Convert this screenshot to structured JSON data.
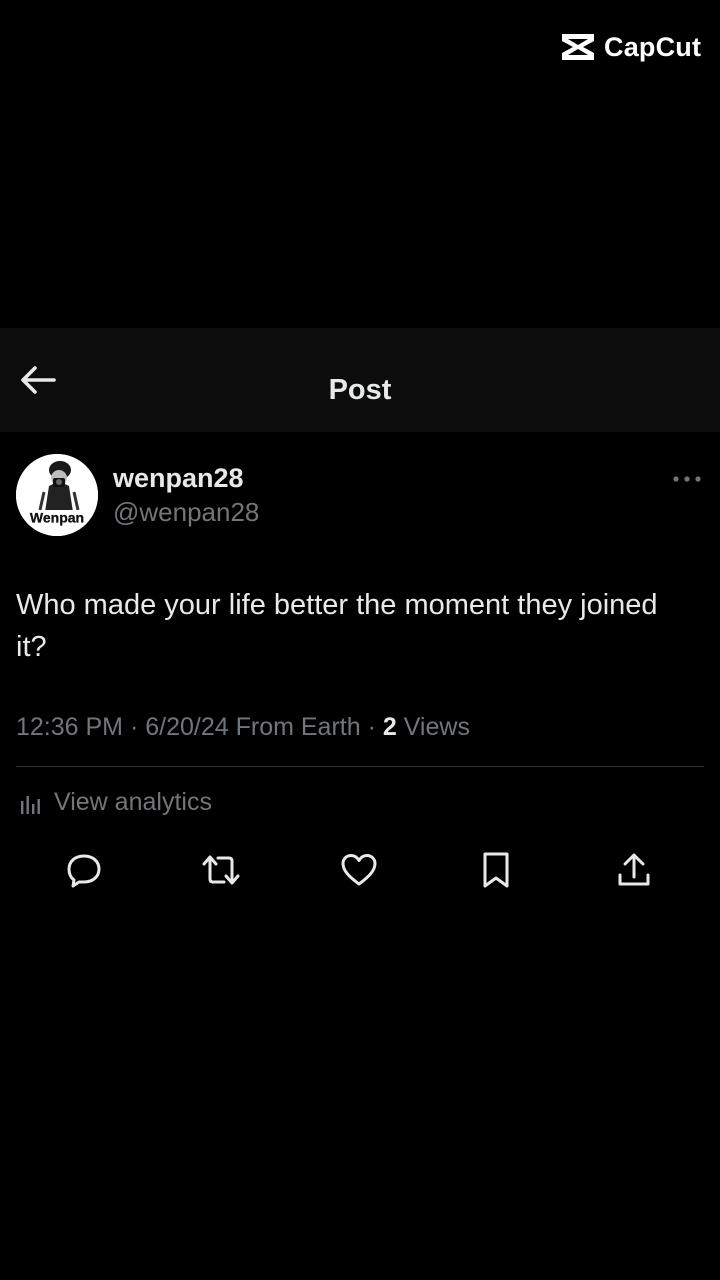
{
  "watermark": {
    "brand": "CapCut",
    "icon": "capcut-logo-icon"
  },
  "header": {
    "title": "Post",
    "back_icon": "arrow-left-icon"
  },
  "post": {
    "author": {
      "display_name": "wenpan28",
      "handle": "@wenpan28",
      "avatar_caption": "Wenpan"
    },
    "text": "Who made your life better the moment they joined it?",
    "meta": {
      "time": "12:36 PM",
      "separator": " · ",
      "date": "6/20/24",
      "location": " From Earth",
      "separator2": " · ",
      "views_count": "2",
      "views_label": " Views"
    },
    "analytics_label": "View analytics",
    "actions": [
      {
        "name": "reply",
        "icon": "reply-icon"
      },
      {
        "name": "repost",
        "icon": "repost-icon"
      },
      {
        "name": "like",
        "icon": "heart-icon"
      },
      {
        "name": "bookmark",
        "icon": "bookmark-icon"
      },
      {
        "name": "share",
        "icon": "share-icon"
      }
    ]
  },
  "colors": {
    "background": "#000000",
    "header_background": "#0c0c0c",
    "primary_text": "#e7e9ea",
    "secondary_text": "#71767b",
    "divider": "#2f3336"
  }
}
